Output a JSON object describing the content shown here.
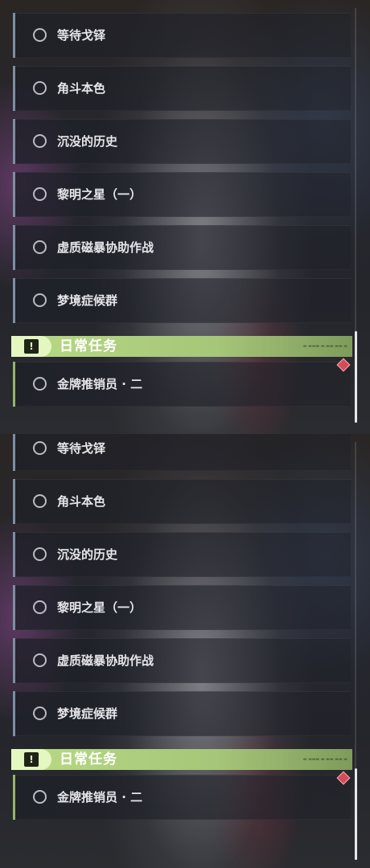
{
  "panels": [
    {
      "story_quests": [
        {
          "label": "等待戈铎"
        },
        {
          "label": "角斗本色"
        },
        {
          "label": "沉没的历史"
        },
        {
          "label": "黎明之星（一）"
        },
        {
          "label": "虚质磁暴协助作战"
        },
        {
          "label": "梦境症候群"
        }
      ],
      "daily_section": {
        "title": "日常任务",
        "icon": "alert-icon"
      },
      "daily_quests": [
        {
          "label": "金牌推销员 · 二"
        }
      ],
      "scrollbar_position": 0.8
    },
    {
      "story_quests": [
        {
          "label": "等待戈铎"
        },
        {
          "label": "角斗本色"
        },
        {
          "label": "沉没的历史"
        },
        {
          "label": "黎明之星（一）"
        },
        {
          "label": "虚质磁暴协助作战"
        },
        {
          "label": "梦境症候群"
        }
      ],
      "daily_section": {
        "title": "日常任务",
        "icon": "alert-icon"
      },
      "daily_quests": [
        {
          "label": "金牌推销员 · 二"
        }
      ],
      "scrollbar_position": 0.8
    }
  ],
  "colors": {
    "story_accent": "#7c8fa3",
    "daily_accent": "#95b468",
    "daily_header": "#b8da84",
    "tracked_marker": "#d64b5a"
  }
}
